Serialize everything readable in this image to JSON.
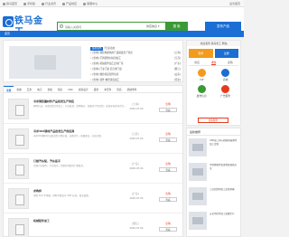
{
  "topbar": {
    "links": [
      "铁马首页",
      "手机版",
      "行业资讯",
      "产品供应",
      "客服中心"
    ],
    "right": "设为首页"
  },
  "header": {
    "logo_text": "铁马金工",
    "search_placeholder": "请输入关键词",
    "search_scope": "供应信息 ▾",
    "search_button": "搜 索",
    "publish_button": "发布产品"
  },
  "nav": {
    "home": "首页"
  },
  "banner": {
    "tag": "最新发布",
    "title_suffix": "行业动态",
    "news": [
      {
        "title": "[供求] 钢结构建筑用产品批发生产供应",
        "loc": "[上海]"
      },
      {
        "title": "[供求] 不锈钢管材切割加工",
        "loc": "[江苏]"
      },
      {
        "title": "[供求] 机械配件加工定制厂家",
        "loc": "[广东]"
      },
      {
        "title": "[供求] 门业门窗 铝合金门窗",
        "loc": "[浙江]"
      },
      {
        "title": "[供求] 数控机床配件供应",
        "loc": "[山东]"
      },
      {
        "title": "[供求] 铸件 精密铸造加工",
        "loc": "[河北]"
      }
    ]
  },
  "login": {
    "welcome": "欢迎来到 铁马金工 网站",
    "login_button": "登录",
    "register_button": "注册",
    "subtabs": [
      "供应",
      "求购",
      "采购"
    ],
    "grid": [
      {
        "label": "VIP",
        "color": "#f39b1c"
      },
      {
        "label": "商城",
        "color": "#1a6ed4"
      },
      {
        "label": "发布信息",
        "color": "#3a9a36"
      },
      {
        "label": "广告服务",
        "color": "#e8391d"
      }
    ],
    "more": "更多服务"
  },
  "list": {
    "cats": [
      "全部",
      "机械",
      "五金",
      "电子",
      "金属",
      "机床",
      "CNC",
      "模具设计",
      "钣金",
      "冲压件",
      "铸造",
      "机械零件"
    ],
    "rows": [
      {
        "title": "寻求钢铁建材件产品批发生产供应",
        "desc": "钢材产品，寻求定制合作加工，产品批发，提供报价，规格尺寸可定制，欢迎来电咨询合作。",
        "loc": "[上海]",
        "date": "2020-07-04",
        "status": "急购",
        "view": "查看"
      },
      {
        "title": "寻求304钢材产品批发生产供应商",
        "desc": "寻求304钢材产品批发生产供应商，长期合作，质量保证，价格合理。",
        "loc": "[江苏]",
        "date": "2020-07-04",
        "status": "急购",
        "view": "查看"
      },
      {
        "title": "订做汽车配，汽车扳手",
        "desc": "订做汽车配件，汽车扳手，需要有经验的厂家联系。",
        "loc": "[广东]",
        "date": "2020-07-04",
        "status": "急购",
        "view": "查看"
      },
      {
        "title": "求购焊",
        "desc": "求购 304 不锈钢，材料不能低于 4M7 标准，现金结算。",
        "loc": "[广东]",
        "date": "2020-07-04",
        "status": "急购",
        "view": "查看"
      },
      {
        "title": "机械配件加工",
        "desc": "",
        "loc": "[浙江]",
        "date": "2020-07-04",
        "status": "急购",
        "view": "查看"
      }
    ]
  },
  "featured": {
    "head": "最新推荐",
    "items": [
      "CNC加工中心精密机械零件加工定制",
      "不锈钢管件批发零售规格齐全",
      "工业铝型材加工定制开模",
      "五金冲压件加工批量生产"
    ]
  }
}
